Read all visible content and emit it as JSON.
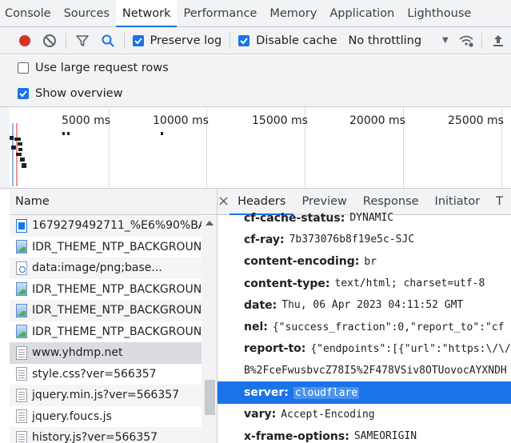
{
  "main_tabs": [
    "Console",
    "Sources",
    "Network",
    "Performance",
    "Memory",
    "Application",
    "Lighthouse"
  ],
  "active_tab": "Network",
  "toolbar": {
    "preserve_log_label": "Preserve log",
    "disable_cache_label": "Disable cache",
    "throttling_value": "No throttling"
  },
  "options": {
    "large_rows_label": "Use large request rows",
    "show_overview_label": "Show overview"
  },
  "overview": {
    "ticks": [
      "5000 ms",
      "10000 ms",
      "15000 ms",
      "20000 ms",
      "25000 ms"
    ]
  },
  "request_list": {
    "column_name": "Name",
    "rows": [
      {
        "name": "1679279492711_%E6%90%BA%",
        "icon": "image-blue-icon"
      },
      {
        "name": "IDR_THEME_NTP_BACKGROUN.",
        "icon": "image-icon"
      },
      {
        "name": "data:image/png;base...",
        "icon": "data-uri-icon"
      },
      {
        "name": "IDR_THEME_NTP_BACKGROUN.",
        "icon": "image-icon"
      },
      {
        "name": "IDR_THEME_NTP_BACKGROUN.",
        "icon": "image-icon"
      },
      {
        "name": "IDR_THEME_NTP_BACKGROUN.",
        "icon": "image-icon"
      },
      {
        "name": "www.yhdmp.net",
        "icon": "document-icon"
      },
      {
        "name": "style.css?ver=566357",
        "icon": "document-icon"
      },
      {
        "name": "jquery.min.js?ver=566357",
        "icon": "document-icon"
      },
      {
        "name": "jquery.foucs.js",
        "icon": "document-icon"
      },
      {
        "name": "history.js?ver=566357",
        "icon": "document-icon"
      }
    ]
  },
  "details": {
    "tabs": [
      "Headers",
      "Preview",
      "Response",
      "Initiator",
      "T"
    ],
    "active_tab": "Headers",
    "headers": [
      {
        "key": "cf-cache-status:",
        "value": "DYNAMIC"
      },
      {
        "key": "cf-ray:",
        "value": "7b373076b8f19e5c-SJC"
      },
      {
        "key": "content-encoding:",
        "value": "br"
      },
      {
        "key": "content-type:",
        "value": "text/html; charset=utf-8"
      },
      {
        "key": "date:",
        "value": "Thu, 06 Apr 2023 04:11:52 GMT"
      },
      {
        "key": "nel:",
        "value": "{\"success_fraction\":0,\"report_to\":\"cf"
      },
      {
        "key": "report-to:",
        "value": "{\"endpoints\":[{\"url\":\"https:\\/\\/a"
      },
      {
        "key": "",
        "value": "B%2FceFwusbvcZ78I5%2F478VSiv8OTUovocAYXNDH"
      },
      {
        "key": "server:",
        "value": "cloudflare"
      },
      {
        "key": "vary:",
        "value": "Accept-Encoding"
      },
      {
        "key": "x-frame-options:",
        "value": "SAMEORIGIN"
      }
    ]
  }
}
